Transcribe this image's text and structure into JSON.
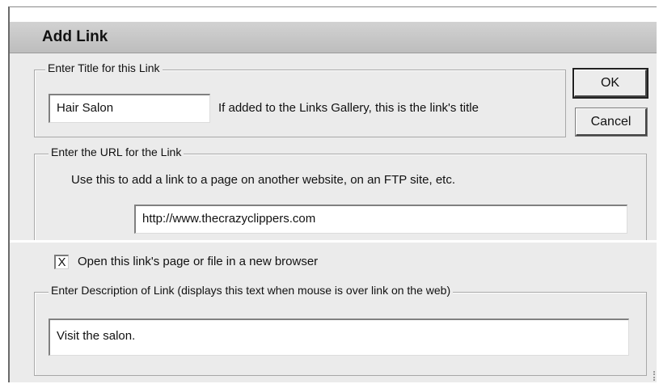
{
  "dialog": {
    "title": "Add Link"
  },
  "title_group": {
    "legend": "Enter Title for this Link",
    "input_value": "Hair Salon",
    "hint": "If added to the Links Gallery, this is the link's title"
  },
  "buttons": {
    "ok_label": "OK",
    "cancel_label": "Cancel"
  },
  "url_group": {
    "legend": "Enter the URL for the Link",
    "help": "Use this to add a link to a page on another website, on an FTP site, etc.",
    "input_value": "http://www.thecrazyclippers.com"
  },
  "new_window": {
    "checked_mark": "X",
    "label": "Open this link's page or file in a new browser"
  },
  "description_group": {
    "legend": "Enter Description of Link (displays this text when mouse is over link on the web)",
    "input_value": "Visit the salon."
  }
}
